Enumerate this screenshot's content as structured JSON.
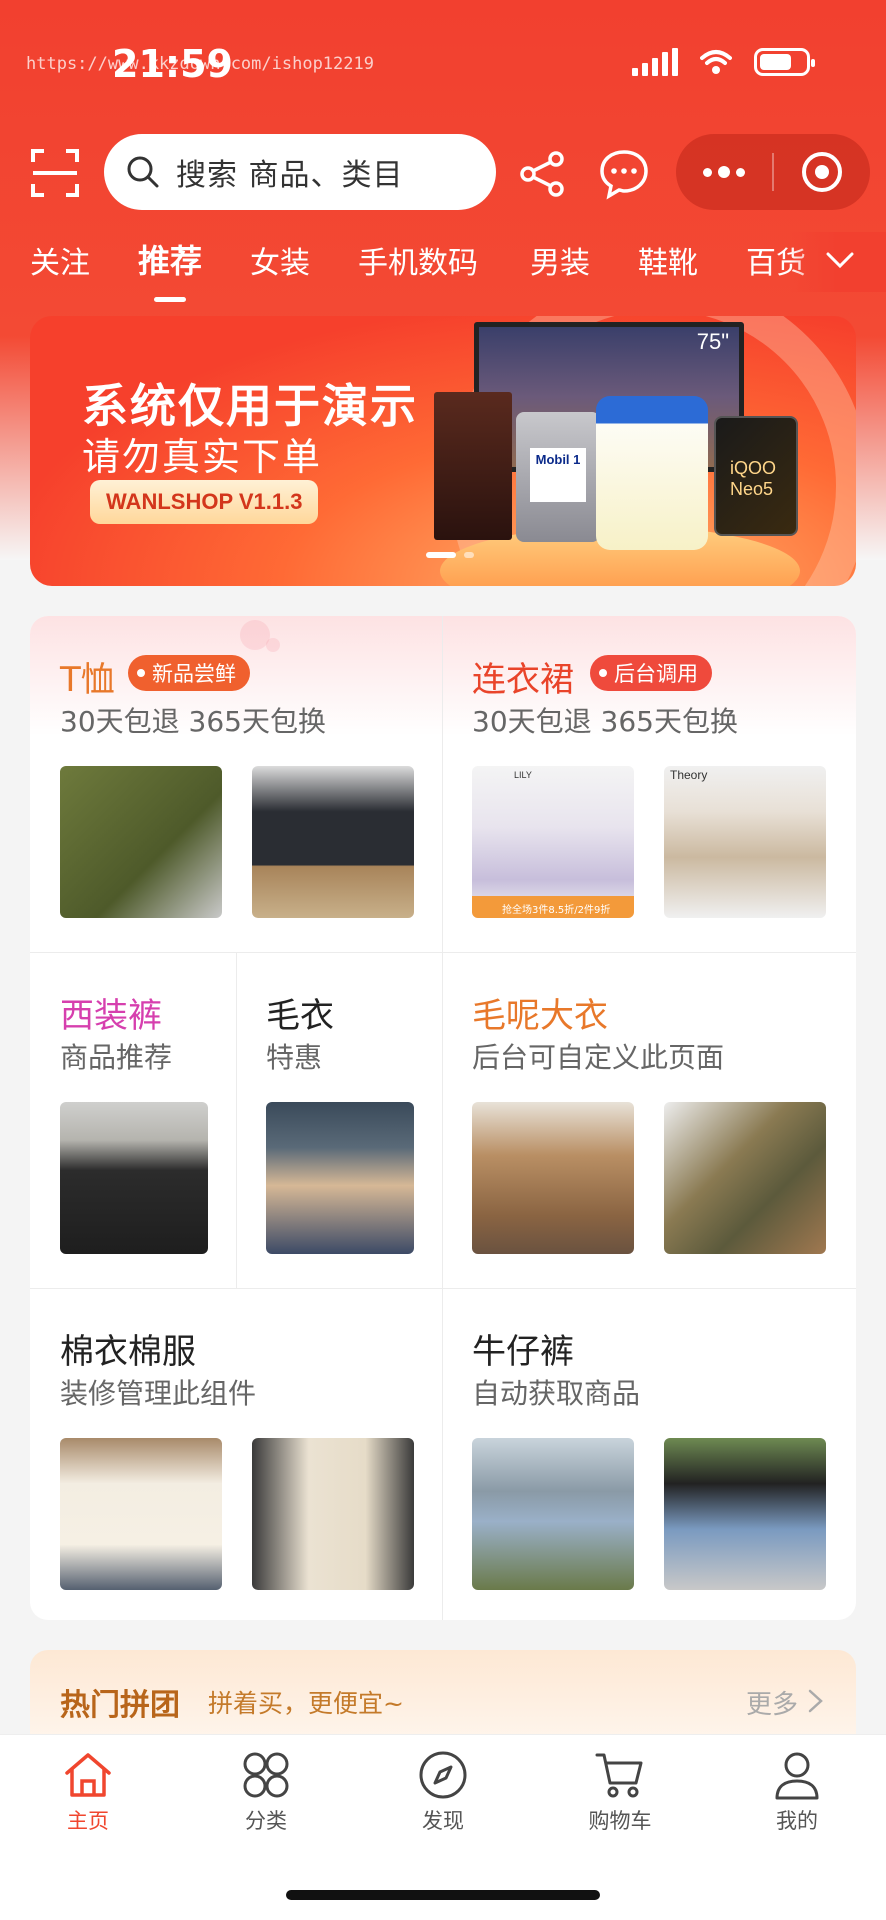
{
  "status_bar": {
    "time": "21:59",
    "url_watermark": "https://www.kkzdown.com/ishop12219"
  },
  "header": {
    "search_placeholder": "搜索 商品、类目",
    "icons": [
      "scan-icon",
      "search-icon",
      "share-icon",
      "chat-icon",
      "more-dots-icon",
      "close-target-icon"
    ]
  },
  "category_tabs": [
    {
      "label": "关注",
      "active": false
    },
    {
      "label": "推荐",
      "active": true
    },
    {
      "label": "女装",
      "active": false
    },
    {
      "label": "手机数码",
      "active": false
    },
    {
      "label": "男装",
      "active": false
    },
    {
      "label": "鞋靴",
      "active": false
    },
    {
      "label": "百货",
      "active": false
    }
  ],
  "banner": {
    "title": "系统仅用于演示",
    "subtitle": "请勿真实下单",
    "badge": "WANLSHOP V1.1.3",
    "tv_size": "75\"",
    "oil_brand": "Mobil 1",
    "phone_brand": "iQOO Neo5"
  },
  "grid": {
    "cells": [
      {
        "title": "T恤",
        "tag": "新品尝鲜",
        "subtitle": "30天包退 365天包换",
        "title_color": "#e8782a",
        "tag_color": "#f0602e"
      },
      {
        "title": "连衣裙",
        "tag": "后台调用",
        "subtitle": "30天包退 365天包换",
        "title_color": "#e9442a",
        "tag_color": "#ef4a3c"
      },
      {
        "title": "西装裤",
        "subtitle": "商品推荐",
        "title_color": "#d63fae"
      },
      {
        "title": "毛衣",
        "subtitle": "特惠",
        "title_color": "#222222"
      },
      {
        "title": "毛呢大衣",
        "subtitle": "后台可自定义此页面",
        "title_color": "#e8782a"
      },
      {
        "title": "棉衣棉服",
        "subtitle": "装修管理此组件",
        "title_color": "#222222"
      },
      {
        "title": "牛仔裤",
        "subtitle": "自动获取商品",
        "title_color": "#222222"
      }
    ],
    "thumb_captions": {
      "dress_brand_1": "LILY",
      "dress_promo": "抢全场3件8.5折/2件9折",
      "dress_brand_2": "Theory"
    }
  },
  "group_buy": {
    "title": "热门拼团",
    "subtitle": "拼着买，更便宜~",
    "more": "更多"
  },
  "tabbar": [
    {
      "label": "主页",
      "icon": "home-icon",
      "active": true
    },
    {
      "label": "分类",
      "icon": "grid-icon",
      "active": false
    },
    {
      "label": "发现",
      "icon": "compass-icon",
      "active": false
    },
    {
      "label": "购物车",
      "icon": "cart-icon",
      "active": false
    },
    {
      "label": "我的",
      "icon": "user-icon",
      "active": false
    }
  ],
  "colors": {
    "brand_red": "#f2402f",
    "active_tab": "#f0462e"
  }
}
